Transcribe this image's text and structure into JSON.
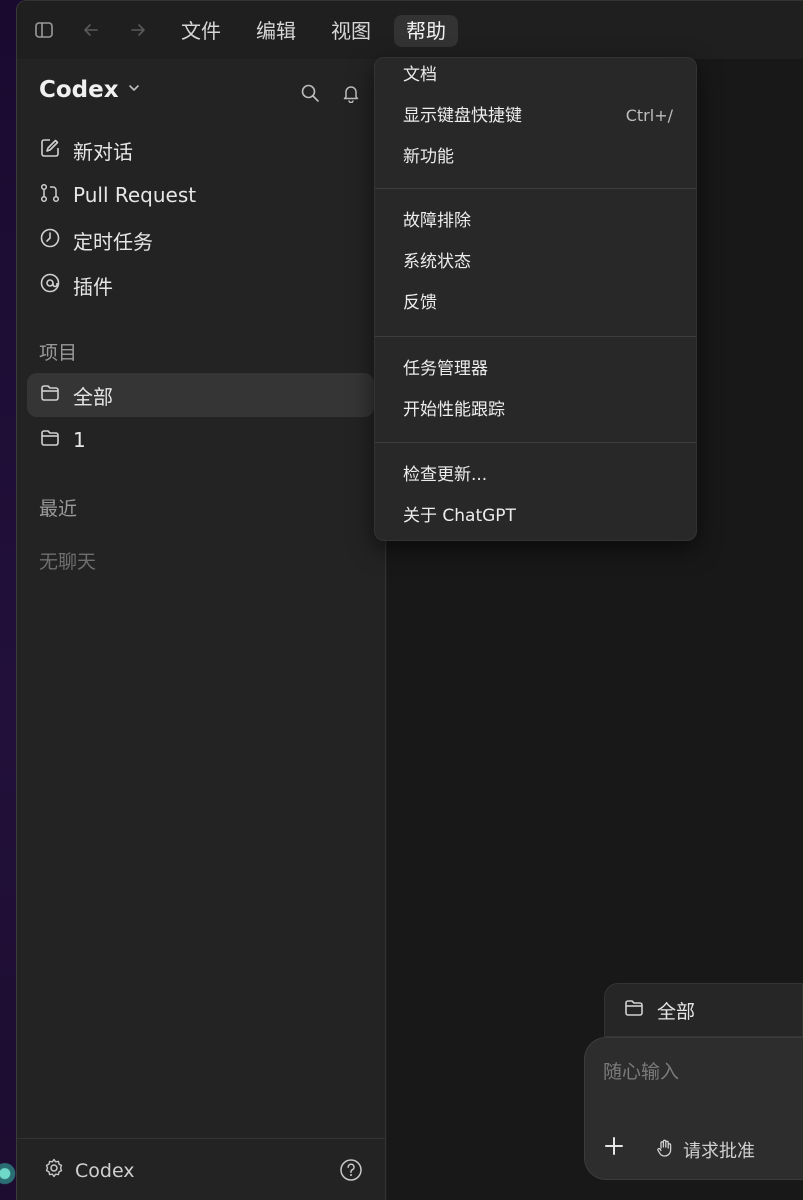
{
  "menubar": {
    "items": [
      {
        "label": "文件"
      },
      {
        "label": "编辑"
      },
      {
        "label": "视图"
      },
      {
        "label": "帮助"
      }
    ]
  },
  "sidebar": {
    "brand": "Codex",
    "nav": [
      {
        "label": "新对话",
        "icon": "edit-icon"
      },
      {
        "label": "Pull Request",
        "icon": "git-pull-request-icon"
      },
      {
        "label": "定时任务",
        "icon": "clock-icon"
      },
      {
        "label": "插件",
        "icon": "plugin-icon"
      }
    ],
    "projects_label": "项目",
    "projects": [
      {
        "label": "全部",
        "selected": true
      },
      {
        "label": "1",
        "selected": false
      }
    ],
    "recent_label": "最近",
    "recent_empty": "无聊天",
    "footer_label": "Codex"
  },
  "help_menu": {
    "groups": [
      [
        {
          "label": "文档"
        },
        {
          "label": "显示键盘快捷键",
          "shortcut": "Ctrl+/"
        },
        {
          "label": "新功能"
        }
      ],
      [
        {
          "label": "故障排除"
        },
        {
          "label": "系统状态"
        },
        {
          "label": "反馈"
        }
      ],
      [
        {
          "label": "任务管理器"
        },
        {
          "label": "开始性能跟踪"
        }
      ],
      [
        {
          "label": "检查更新..."
        },
        {
          "label": "关于 ChatGPT"
        }
      ]
    ]
  },
  "composer": {
    "project": "全部",
    "placeholder": "随心输入",
    "approval_label": "请求批准"
  },
  "colors": {
    "window_bg": "#1e1e1e",
    "sidebar_bg": "#232323",
    "menu_bg": "#282828",
    "selected_bg": "#353535",
    "desktop_bg": "#1b0c2e"
  }
}
